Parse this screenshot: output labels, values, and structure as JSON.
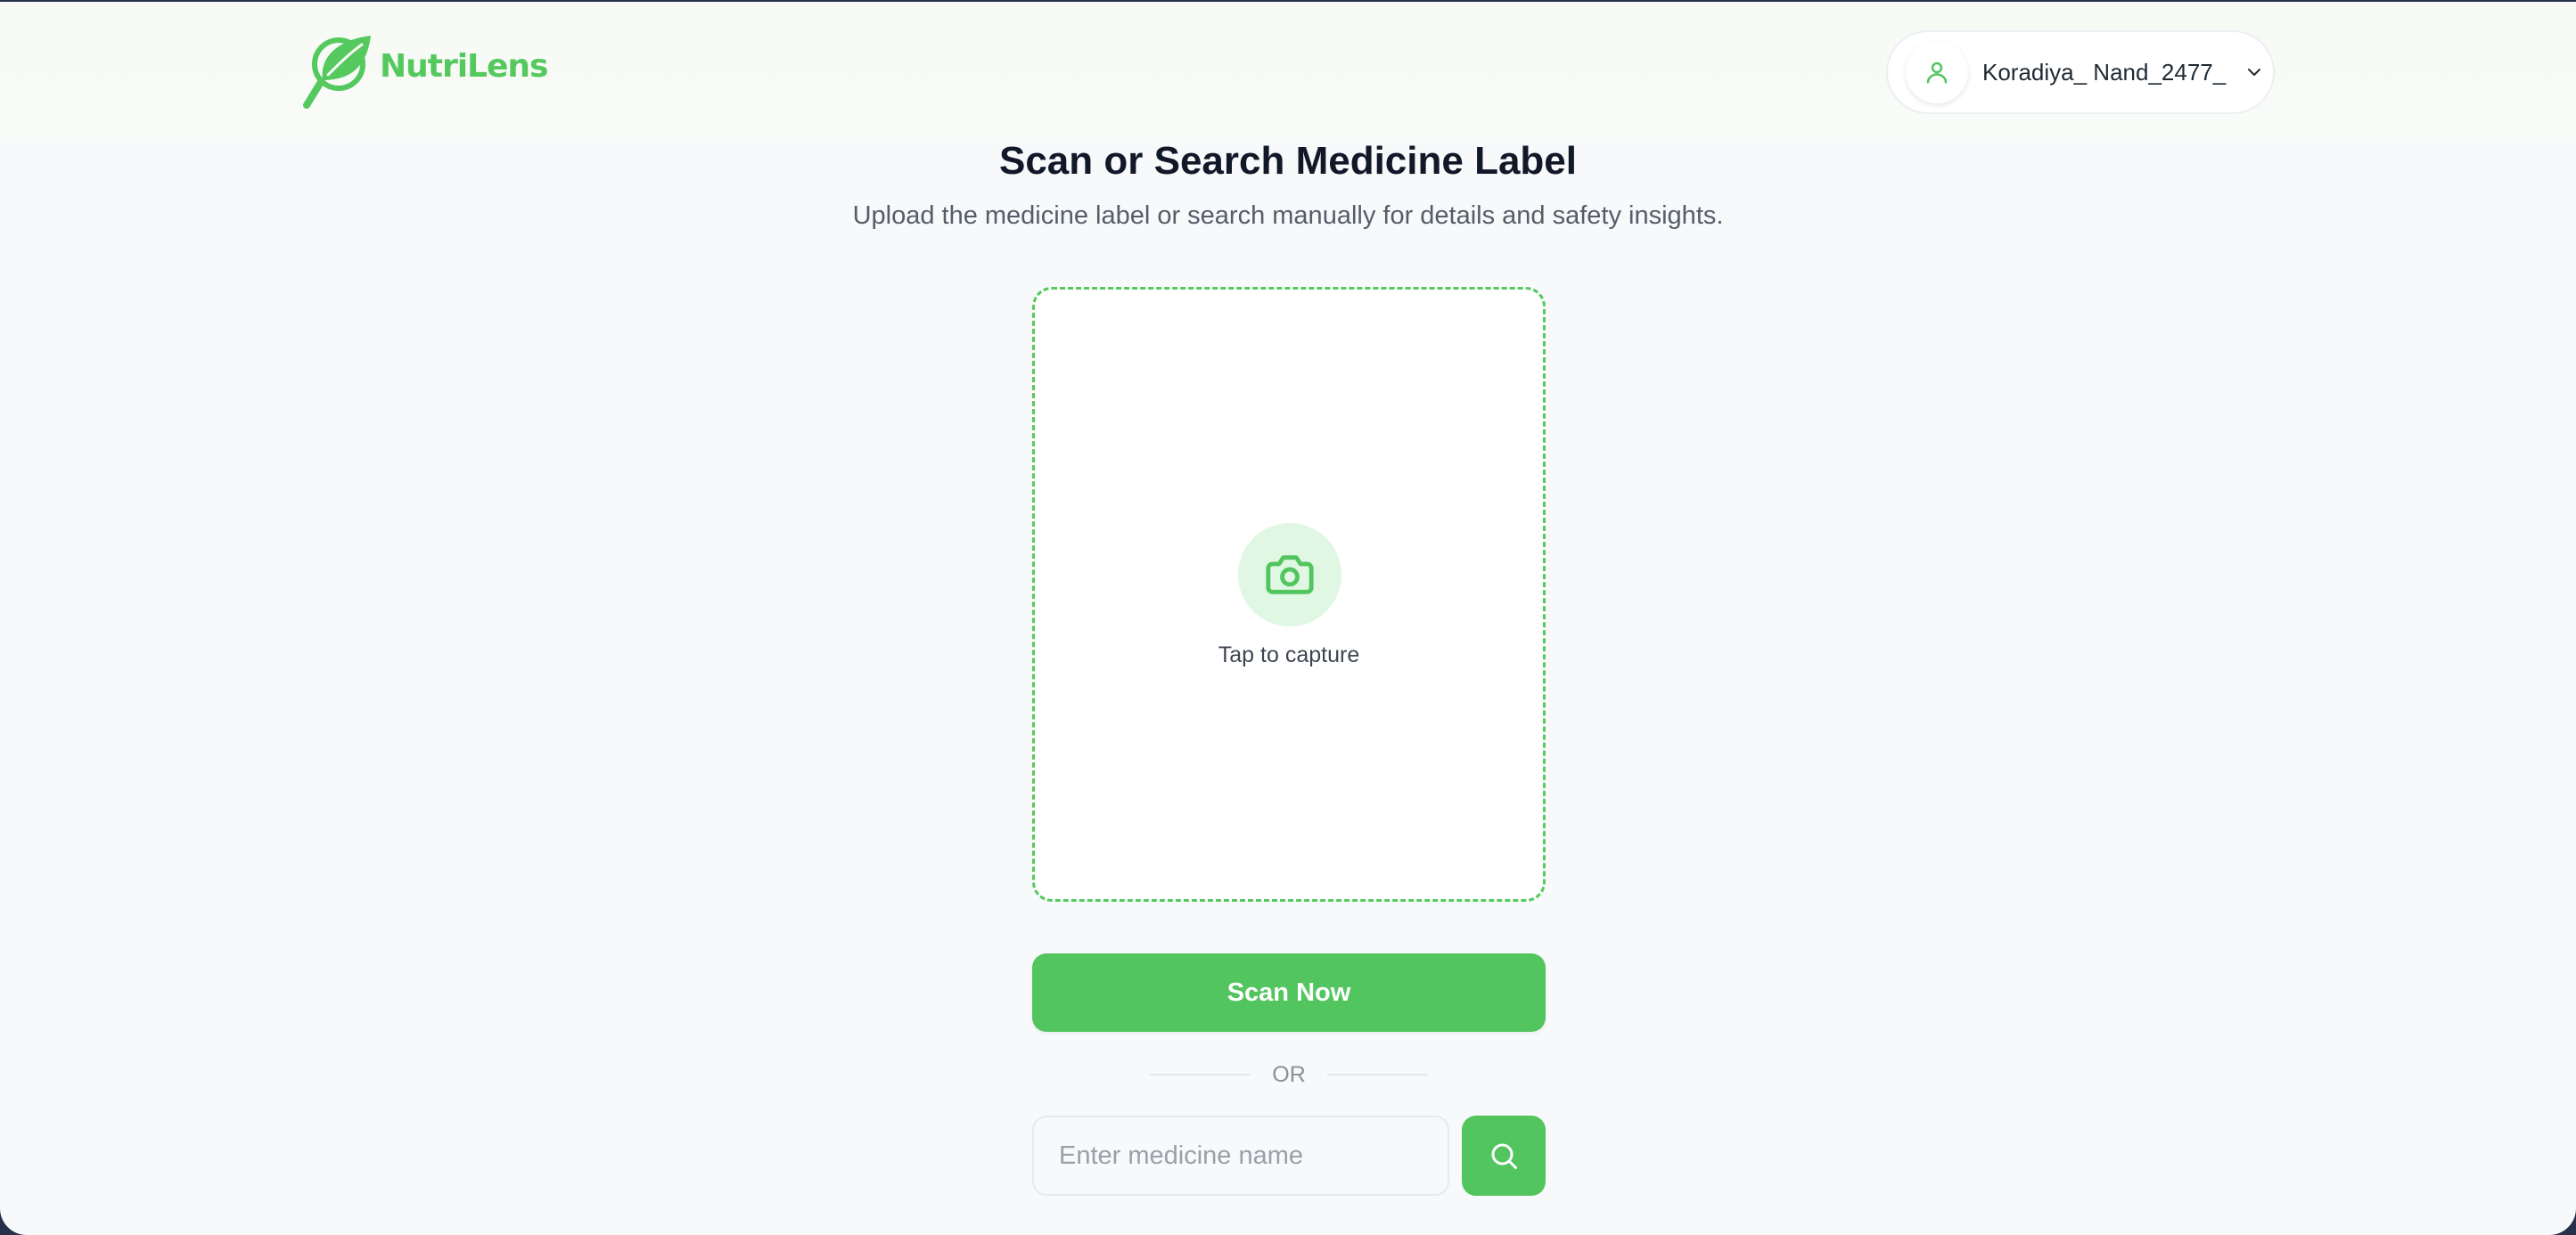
{
  "header": {
    "brand": "NutriLens",
    "user": {
      "name": "Koradiya_ Nand_2477_",
      "avatar_icon": "user-icon",
      "menu_icon": "chevron-down-icon"
    }
  },
  "main": {
    "title": "Scan or Search Medicine Label",
    "subtitle": "Upload the medicine label or search manually for details and safety insights.",
    "capture": {
      "icon": "camera-icon",
      "label": "Tap to capture"
    },
    "scan_button": "Scan Now",
    "divider": "OR",
    "search": {
      "placeholder": "Enter medicine name",
      "value": "",
      "button_icon": "search-icon"
    }
  },
  "colors": {
    "accent": "#52c55f",
    "accent_light": "#dff7e3",
    "title": "#111827",
    "subtitle": "#555d68"
  }
}
